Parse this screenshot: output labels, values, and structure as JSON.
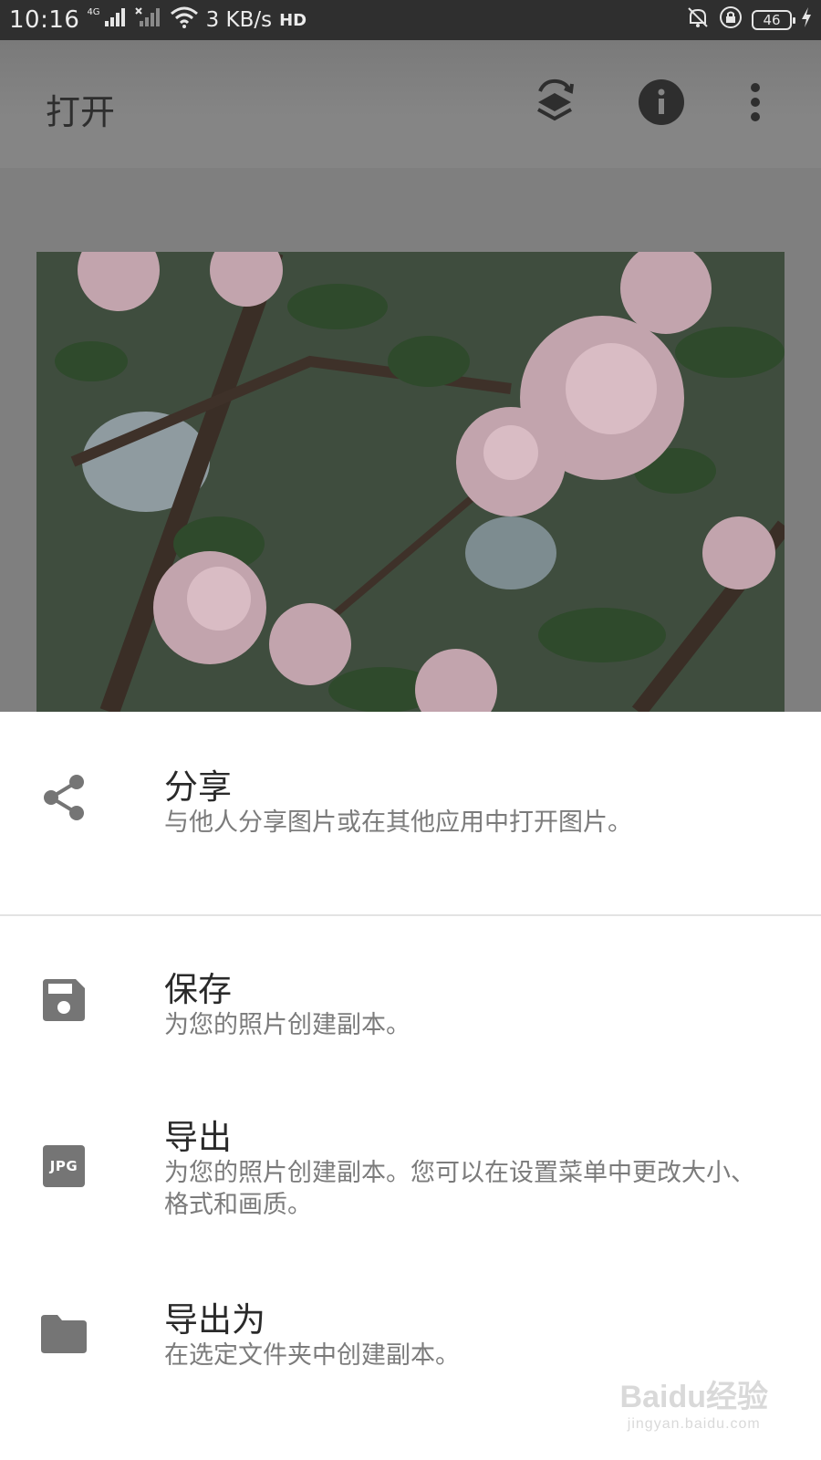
{
  "status_bar": {
    "time": "10:16",
    "network_tag": "4G",
    "speed": "3 KB/s",
    "hd_label": "HD",
    "battery": "46"
  },
  "app_bar": {
    "title": "打开"
  },
  "sheet": {
    "items": [
      {
        "title": "分享",
        "subtitle": "与他人分享图片或在其他应用中打开图片。",
        "icon": "share-icon"
      },
      {
        "title": "保存",
        "subtitle": "为您的照片创建副本。",
        "icon": "save-icon"
      },
      {
        "title": "导出",
        "subtitle": "为您的照片创建副本。您可以在设置菜单中更改大小、格式和画质。",
        "icon": "jpg-icon",
        "icon_text": "JPG"
      },
      {
        "title": "导出为",
        "subtitle": "在选定文件夹中创建副本。",
        "icon": "folder-icon"
      }
    ]
  },
  "watermark": {
    "brand": "Baidu经验",
    "url": "jingyan.baidu.com"
  },
  "colors": {
    "status_bar": "#2f2f2f",
    "dim_overlay": "#7f7f7f",
    "sheet_bg": "#ffffff",
    "icon_gray": "#757575",
    "title_text": "#2a2a2a",
    "subtitle_text": "#7b7b7b"
  }
}
